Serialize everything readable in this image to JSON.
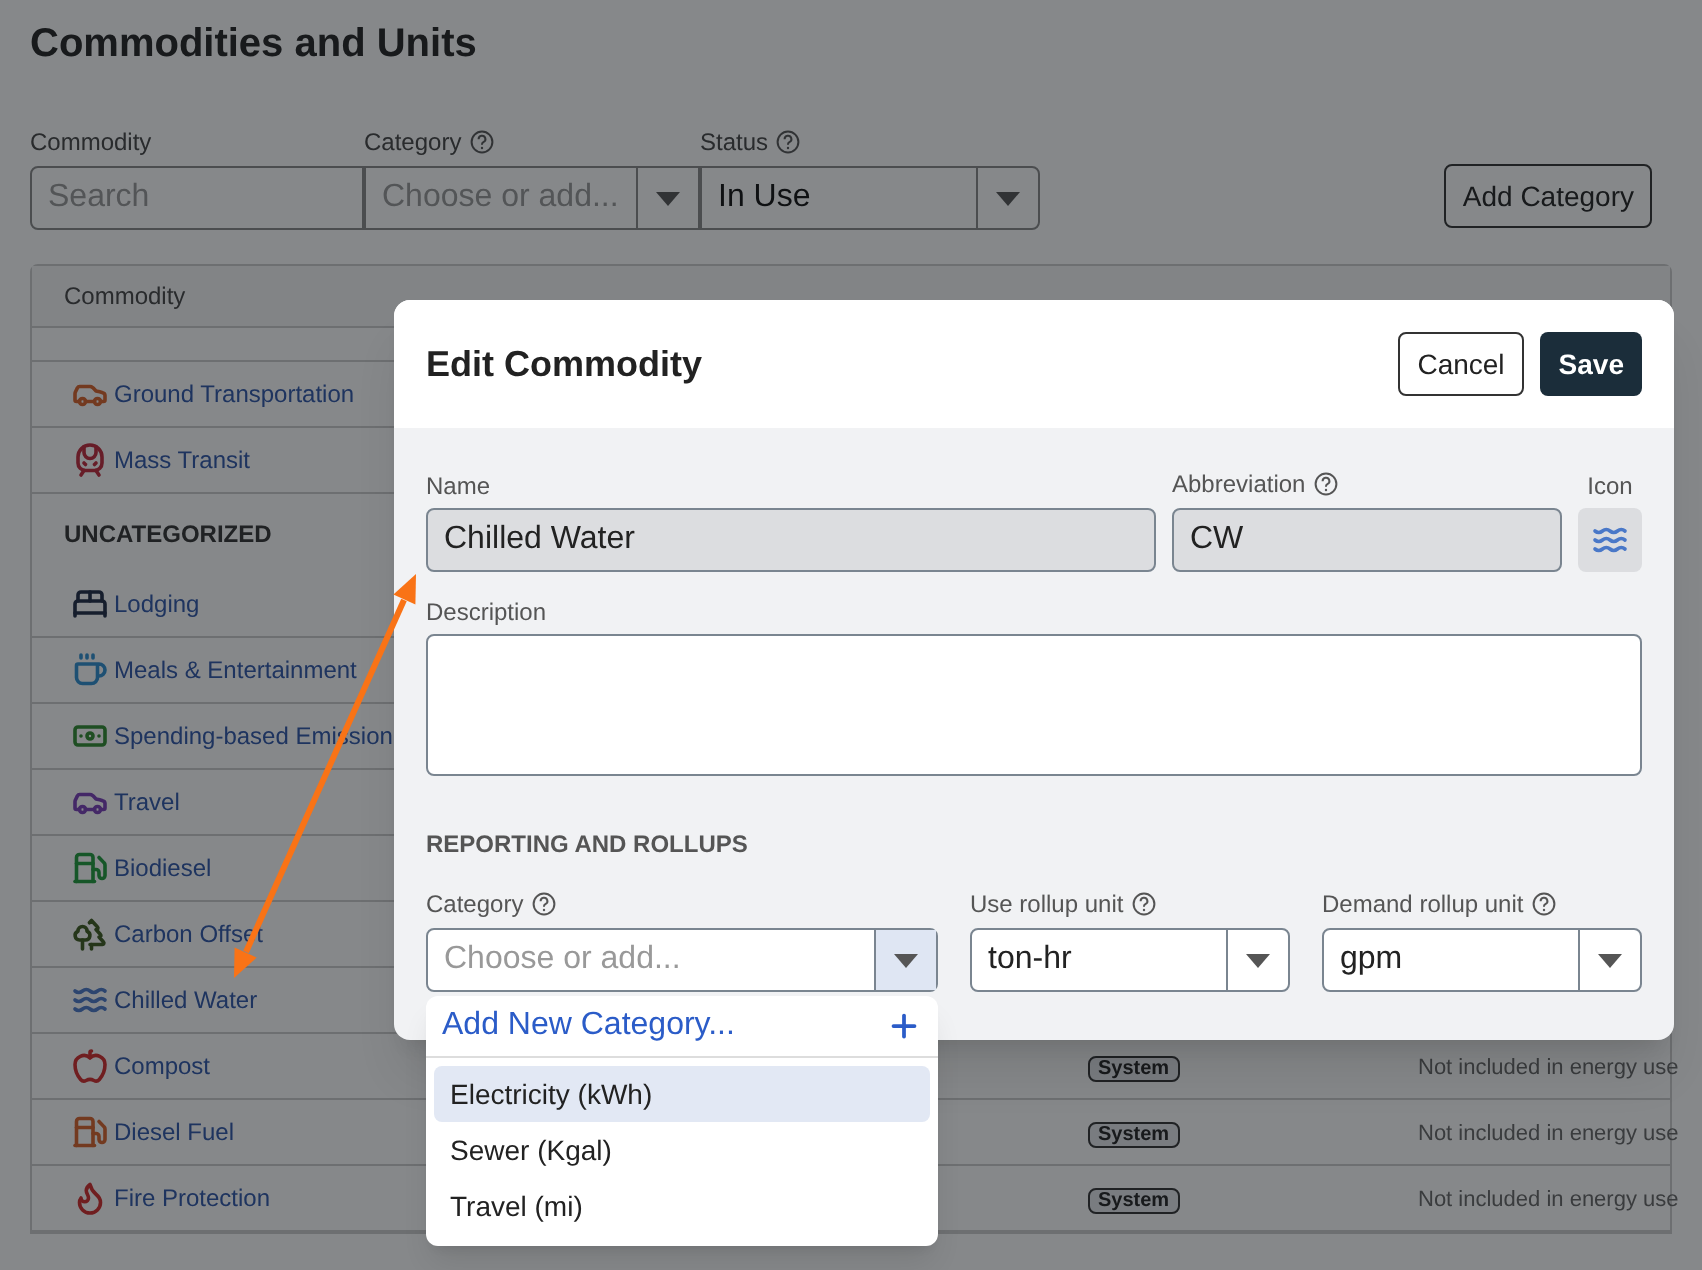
{
  "page": {
    "title": "Commodities and Units"
  },
  "filters": [
    {
      "kind": "search",
      "label": "Commodity",
      "help": false,
      "placeholder": "Search"
    },
    {
      "kind": "select",
      "label": "Category",
      "help": true,
      "placeholder": "Choose or add..."
    },
    {
      "kind": "select",
      "label": "Status",
      "help": true,
      "value": "In Use"
    }
  ],
  "actions": [
    "Add Category"
  ],
  "table": {
    "columns": [
      {
        "label": "Commodity"
      }
    ],
    "rows": [
      {
        "kind": "item",
        "name": "Ground Transportation"
      },
      {
        "kind": "item",
        "name": "Mass Transit"
      },
      {
        "kind": "section",
        "name": "UNCATEGORIZED"
      },
      {
        "kind": "item",
        "name": "Lodging"
      },
      {
        "kind": "item",
        "name": "Meals & Entertainment"
      },
      {
        "kind": "item",
        "name": "Spending-based Emission"
      },
      {
        "kind": "item",
        "name": "Travel"
      },
      {
        "kind": "item",
        "name": "Biodiesel"
      },
      {
        "kind": "item",
        "name": "Carbon Offset"
      },
      {
        "kind": "item",
        "name": "Chilled Water"
      },
      {
        "kind": "item",
        "name": "Compost",
        "type": "System",
        "conversion": "Not included in energy use"
      },
      {
        "kind": "item",
        "name": "Diesel Fuel",
        "type": "System",
        "conversion": "Not included in energy use"
      },
      {
        "kind": "item",
        "name": "Fire Protection",
        "type": "System",
        "conversion": "Not included in energy use"
      }
    ]
  },
  "modal": {
    "title": "Edit Commodity",
    "buttons": [
      {
        "kind": "secondary",
        "label": "Cancel"
      },
      {
        "kind": "primary",
        "label": "Save"
      }
    ],
    "name": {
      "label": "Name",
      "value": "Chilled Water"
    },
    "abbreviation": {
      "label": "Abbreviation",
      "help": true,
      "value": "CW"
    },
    "icon": {
      "label": "Icon"
    },
    "description": {
      "label": "Description"
    },
    "section": "REPORTING AND ROLLUPS",
    "selects": [
      {
        "label": "Category",
        "help": true,
        "placeholder": "Choose or add...",
        "expanded": true
      },
      {
        "label": "Use rollup unit",
        "help": true,
        "value": "ton-hr",
        "expanded": false
      },
      {
        "label": "Demand rollup unit",
        "help": true,
        "value": "gpm",
        "expanded": false
      }
    ],
    "menu": {
      "add_label": "Add New Category...",
      "options": [
        {
          "label": "Electricity (kWh)",
          "selected": true
        },
        {
          "label": "Sewer (Kgal)",
          "selected": false
        },
        {
          "label": "Travel (mi)",
          "selected": false
        }
      ]
    }
  }
}
